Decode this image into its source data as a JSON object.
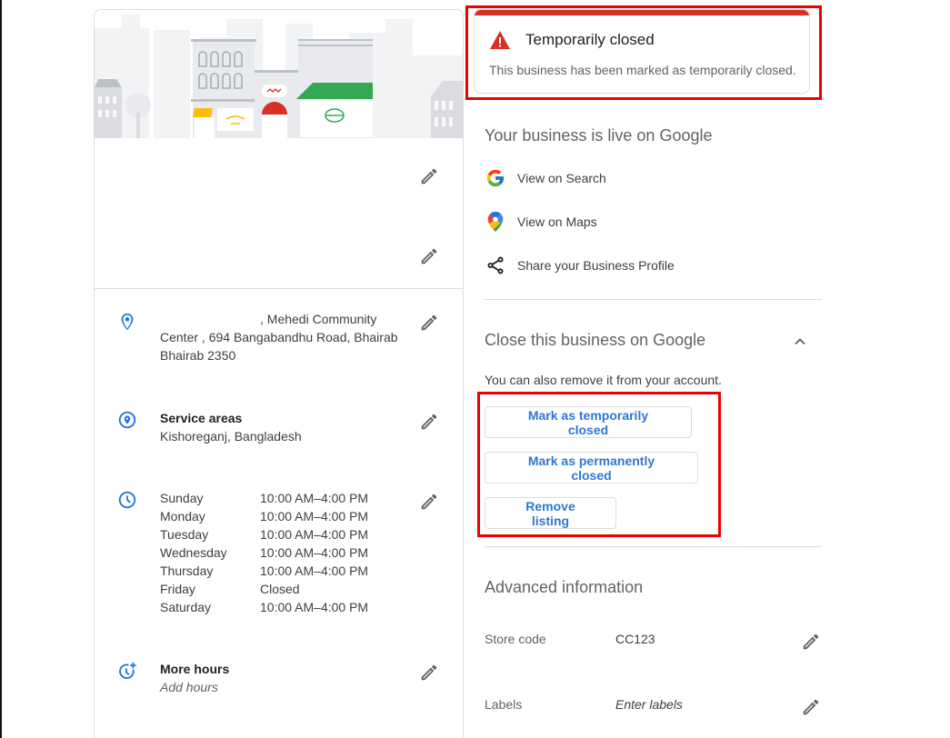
{
  "profile_card": {
    "address": {
      "line1_suffix": ", Mehedi Community",
      "line2": "Center , 694 Bangabandhu Road, Bhairab",
      "line3": "Bhairab 2350"
    },
    "service_areas": {
      "title": "Service areas",
      "value": "Kishoreganj, Bangladesh"
    },
    "hours": [
      {
        "day": "Sunday",
        "time": "10:00 AM–4:00 PM"
      },
      {
        "day": "Monday",
        "time": "10:00 AM–4:00 PM"
      },
      {
        "day": "Tuesday",
        "time": "10:00 AM–4:00 PM"
      },
      {
        "day": "Wednesday",
        "time": "10:00 AM–4:00 PM"
      },
      {
        "day": "Thursday",
        "time": "10:00 AM–4:00 PM"
      },
      {
        "day": "Friday",
        "time": "Closed"
      },
      {
        "day": "Saturday",
        "time": "10:00 AM–4:00 PM"
      }
    ],
    "more_hours": {
      "title": "More hours",
      "placeholder": "Add hours"
    }
  },
  "alert": {
    "icon": "warning-icon",
    "title": "Temporarily closed",
    "message": "This business has been marked as temporarily closed.",
    "color": "#d93025"
  },
  "live_section": {
    "title": "Your business is live on Google",
    "links": [
      {
        "icon": "google-g-icon",
        "label": "View on Search"
      },
      {
        "icon": "google-maps-pin-icon",
        "label": "View on Maps"
      },
      {
        "icon": "share-icon",
        "label": "Share your Business Profile"
      }
    ]
  },
  "close_section": {
    "title": "Close this business on Google",
    "subtitle": "You can also remove it from your account.",
    "expanded": true,
    "buttons": [
      {
        "label": "Mark as temporarily closed"
      },
      {
        "label": "Mark as permanently closed"
      },
      {
        "label": "Remove listing"
      }
    ]
  },
  "advanced_section": {
    "title": "Advanced information",
    "fields": [
      {
        "label": "Store code",
        "value": "CC123"
      },
      {
        "label": "Labels",
        "placeholder": "Enter labels"
      }
    ]
  },
  "colors": {
    "accent": "#1a73e8",
    "highlight_outline": "#ee0000",
    "icon_blue": "#1a73e8"
  }
}
